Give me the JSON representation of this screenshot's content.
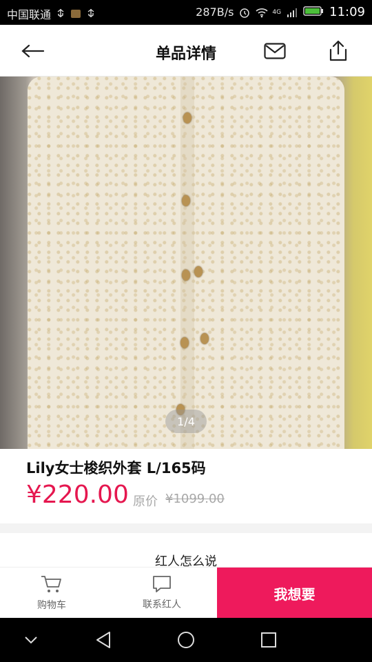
{
  "status_bar": {
    "carrier": "中国联通",
    "net_speed": "287B/s",
    "network": "4G",
    "time": "11:09"
  },
  "header": {
    "title": "单品详情",
    "icons": [
      "back-arrow-icon",
      "mail-icon",
      "share-icon"
    ]
  },
  "product": {
    "image_pager": "1/4",
    "name": "Lily女士梭织外套 L/165码",
    "price": "¥220.00",
    "original_price_label": "原价",
    "original_price": "¥1099.00"
  },
  "section": {
    "title": "红人怎么说"
  },
  "bottom_bar": {
    "cart_label": "购物车",
    "contact_label": "联系红人",
    "want_label": "我想要",
    "accent_color": "#ee1a5c"
  },
  "colors": {
    "price": "#e5174f",
    "muted": "#a8a8a8"
  }
}
